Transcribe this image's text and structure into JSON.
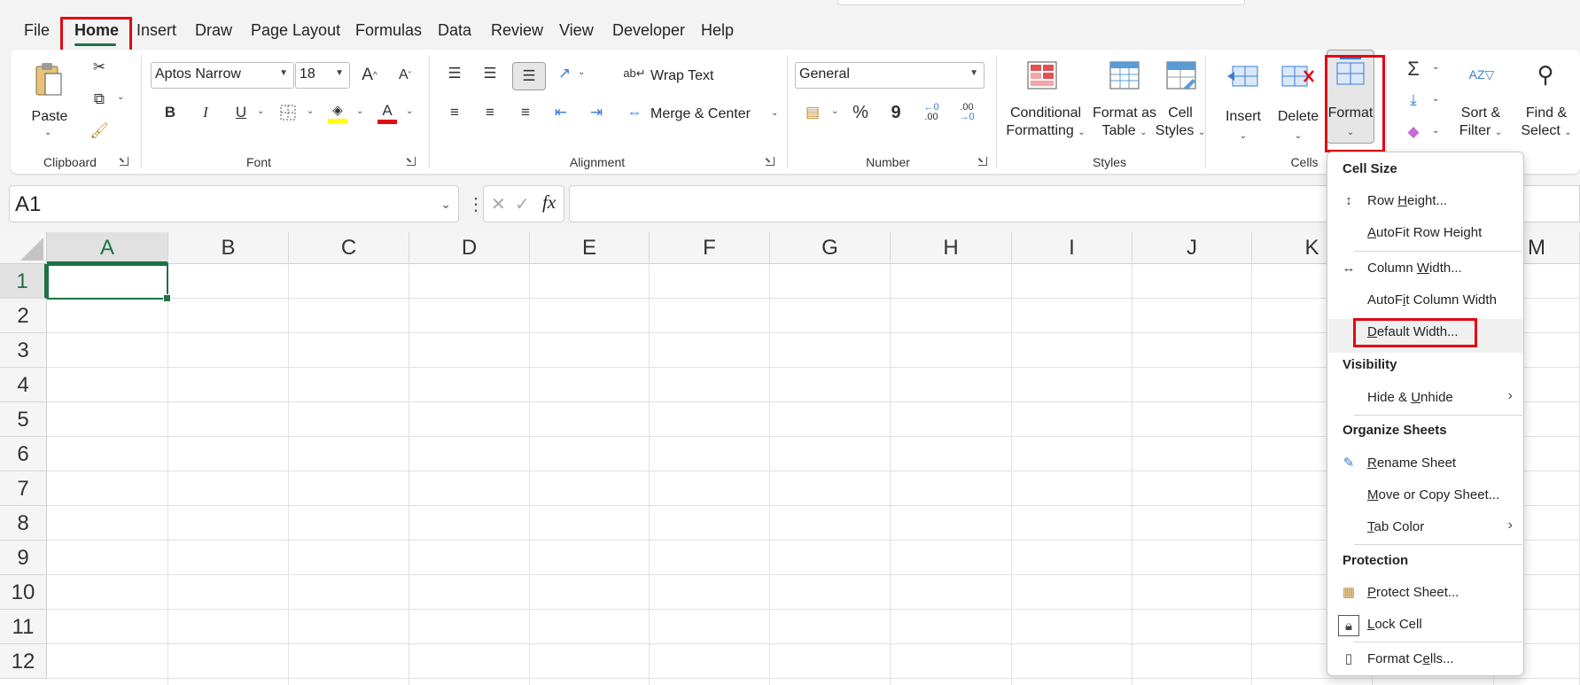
{
  "menu_tabs": [
    "File",
    "Home",
    "Insert",
    "Draw",
    "Page Layout",
    "Formulas",
    "Data",
    "Review",
    "View",
    "Developer",
    "Help"
  ],
  "ribbon": {
    "clipboard": {
      "paste": "Paste",
      "group": "Clipboard"
    },
    "font": {
      "name": "Aptos Narrow",
      "size": "18",
      "bold": "B",
      "italic": "I",
      "underline": "U",
      "grow": "A",
      "shrink": "A",
      "color_letter": "A",
      "group": "Font"
    },
    "alignment": {
      "wrap": "Wrap Text",
      "merge": "Merge & Center",
      "group": "Alignment"
    },
    "number": {
      "format": "General",
      "percent": "%",
      "comma": "9",
      "inc_dec": ".00",
      "dec_dec": ".00",
      "group": "Number"
    },
    "styles": {
      "conditional_1": "Conditional",
      "conditional_2": "Formatting",
      "format_table_1": "Format as",
      "format_table_2": "Table",
      "cell_styles_1": "Cell",
      "cell_styles_2": "Styles",
      "group": "Styles"
    },
    "cells": {
      "insert": "Insert",
      "delete": "Delete",
      "format": "Format",
      "group": "Cells"
    },
    "editing": {
      "sort_1": "Sort &",
      "sort_2": "Filter",
      "find_1": "Find &",
      "find_2": "Select"
    }
  },
  "name_box": "A1",
  "fx": "fx",
  "columns": [
    "A",
    "B",
    "C",
    "D",
    "E",
    "F",
    "G",
    "H",
    "I",
    "J",
    "K",
    "L",
    "M"
  ],
  "rows": [
    "1",
    "2",
    "3",
    "4",
    "5",
    "6",
    "7",
    "8",
    "9",
    "10",
    "11",
    "12"
  ],
  "format_menu": {
    "cell_size": "Cell Size",
    "row_height": {
      "before": "Row ",
      "key": "H",
      "after": "eight..."
    },
    "autofit_row": {
      "before": "",
      "key": "A",
      "after": "utoFit Row Height"
    },
    "column_width": {
      "before": "Column ",
      "key": "W",
      "after": "idth..."
    },
    "autofit_col": {
      "before": "AutoF",
      "key": "i",
      "after": "t Column Width"
    },
    "default_width": {
      "before": "",
      "key": "D",
      "after": "efault Width..."
    },
    "visibility": "Visibility",
    "hide_unhide": {
      "before": "Hide & ",
      "key": "U",
      "after": "nhide"
    },
    "organize": "Organize Sheets",
    "rename": {
      "before": "",
      "key": "R",
      "after": "ename Sheet"
    },
    "move_copy": {
      "before": "",
      "key": "M",
      "after": "ove or Copy Sheet..."
    },
    "tab_color": {
      "before": "",
      "key": "T",
      "after": "ab Color"
    },
    "protection": "Protection",
    "protect": {
      "before": "",
      "key": "P",
      "after": "rotect Sheet..."
    },
    "lock": {
      "before": "",
      "key": "L",
      "after": "ock Cell"
    },
    "format_cells": {
      "before": "Format C",
      "key": "e",
      "after": "lls..."
    }
  },
  "colors": {
    "accent": "#1e7145",
    "highlight": "#e30613"
  }
}
